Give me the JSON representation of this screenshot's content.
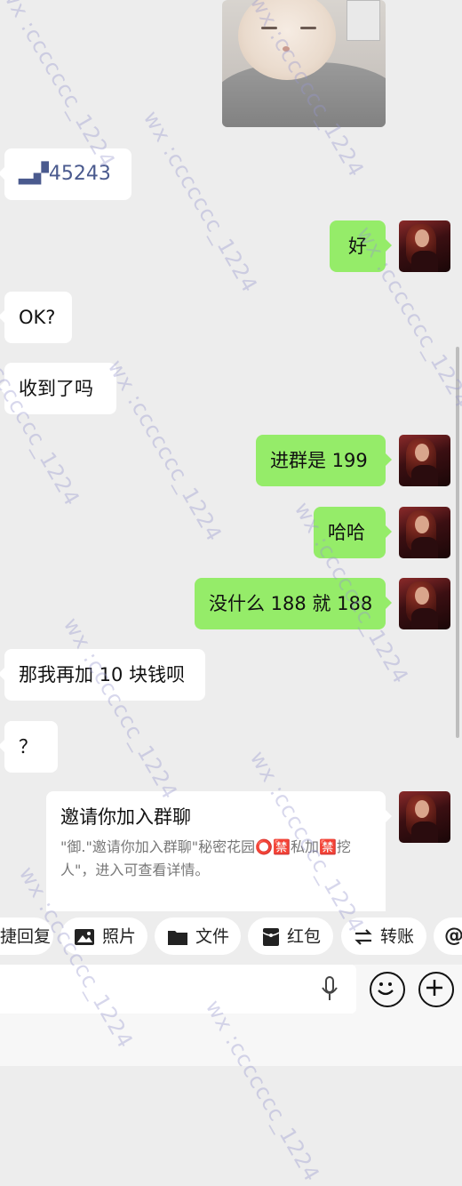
{
  "messages": {
    "m1": "▂▞45243",
    "m2": "好",
    "m3": "OK?",
    "m4": "收到了吗",
    "m5": "进群是 199",
    "m6": "哈哈",
    "m7": "没什么 188 就 188",
    "m8": "那我再加 10 块钱呗",
    "m9": "？"
  },
  "invite": {
    "title": "邀请你加入群聊",
    "description": "\"御.\"邀请你加入群聊\"秘密花园⭕🈲私加🈲挖人\"，进入可查看详情。"
  },
  "quickbar": {
    "chips": [
      "捷回复",
      "照片",
      "文件",
      "红包",
      "转账",
      "@"
    ]
  },
  "watermark": "wx :ccccccc_1224",
  "icons": {
    "photo": "photo-icon",
    "file": "folder-icon",
    "redpacket": "red-packet-icon",
    "transfer": "transfer-icon",
    "voice": "mic-icon",
    "emoji": "emoji-icon",
    "plus": "plus-icon"
  },
  "colors": {
    "outgoing_bubble": "#95ec69",
    "incoming_bubble": "#ffffff",
    "background": "#ededed"
  }
}
